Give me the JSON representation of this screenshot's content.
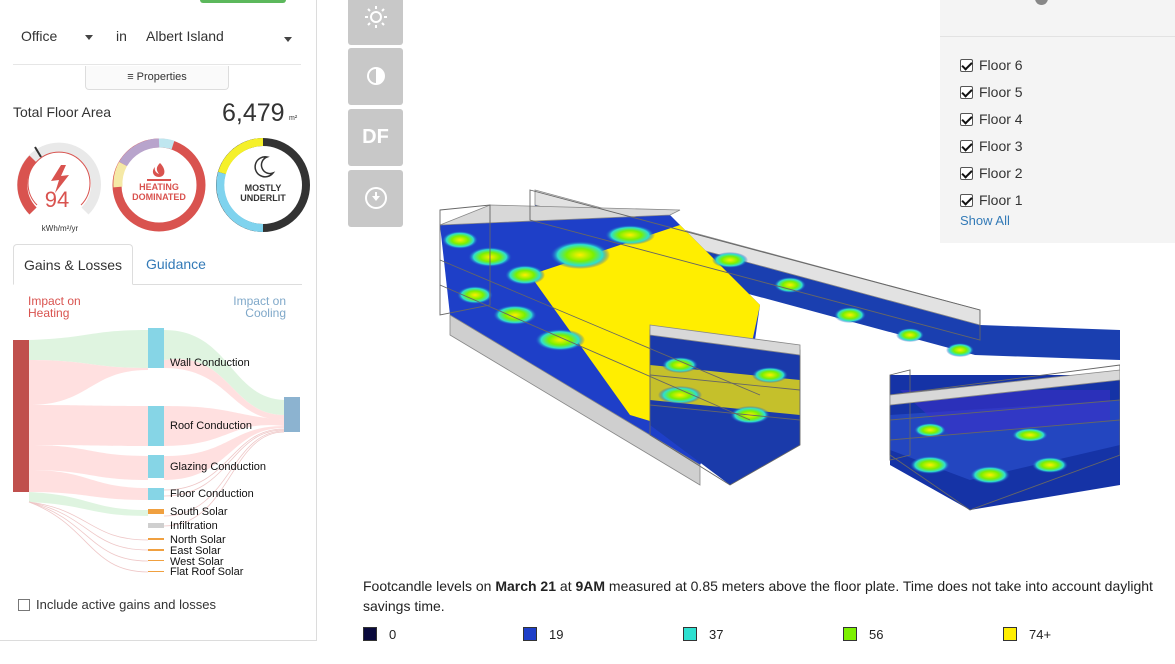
{
  "building": {
    "type": "Office",
    "in_label": "in",
    "location": "Albert Island",
    "properties_label": "Properties",
    "total_floor_area_label": "Total Floor Area",
    "total_floor_area_value": "6,479",
    "total_floor_area_unit": "m²"
  },
  "gauges": {
    "eui_value": "94",
    "eui_unit": "kWh/m²/yr",
    "heating_line1": "HEATING",
    "heating_line2": "DOMINATED",
    "light_line1": "MOSTLY",
    "light_line2": "UNDERLIT",
    "colors": {
      "heat": "#d9534f",
      "cool": "#5bc0de",
      "dark": "#333333",
      "yellow": "#f5f02a"
    }
  },
  "tabs": [
    {
      "label": "Gains & Losses",
      "active": true
    },
    {
      "label": "Guidance",
      "active": false
    }
  ],
  "impact": {
    "heating": [
      "Impact on",
      "Heating"
    ],
    "cooling": [
      "Impact on",
      "Cooling"
    ]
  },
  "sankey_items": [
    "Wall Conduction",
    "Roof Conduction",
    "Glazing Conduction",
    "Floor Conduction",
    "South Solar",
    "Infiltration",
    "North Solar",
    "East Solar",
    "West Solar",
    "Flat Roof Solar"
  ],
  "active_gains_label": "Include active gains and losses",
  "toolbar": {
    "df_label": "DF",
    "icons": [
      "sun-icon",
      "contrast-icon",
      "df-icon",
      "download-icon"
    ]
  },
  "floors": {
    "items": [
      {
        "label": "Floor 6",
        "checked": true
      },
      {
        "label": "Floor 5",
        "checked": true
      },
      {
        "label": "Floor 4",
        "checked": true
      },
      {
        "label": "Floor 3",
        "checked": true
      },
      {
        "label": "Floor 2",
        "checked": true
      },
      {
        "label": "Floor 1",
        "checked": true
      }
    ],
    "show_all_label": "Show All"
  },
  "caption": {
    "prefix": "Footcandle levels on ",
    "date": "March 21",
    "at": " at ",
    "time": "9AM",
    "suffix": " measured at 0.85 meters above the floor plate. Time does not take into account daylight savings time."
  },
  "legend": [
    {
      "label": "0",
      "color": "#0a0a3c"
    },
    {
      "label": "19",
      "color": "#1e3fc8"
    },
    {
      "label": "37",
      "color": "#2ee0d0"
    },
    {
      "label": "56",
      "color": "#7cf000"
    },
    {
      "label": "74+",
      "color": "#ffee00"
    }
  ]
}
